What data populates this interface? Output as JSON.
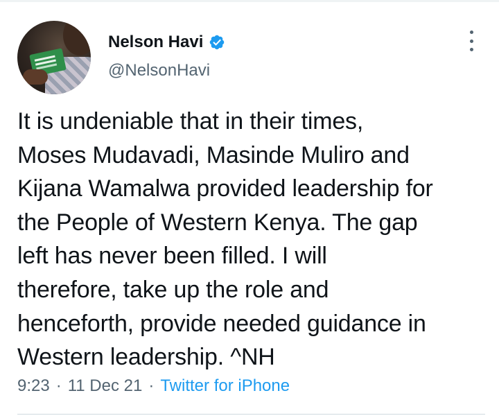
{
  "author": {
    "display_name": "Nelson Havi",
    "handle": "@NelsonHavi",
    "verified": true
  },
  "tweet": {
    "text": "It is undeniable that in their times,\nMoses Mudavadi, Masinde Muliro and\nKijana Wamalwa provided leadership for\nthe People of Western Kenya. The gap\nleft has never been filled. I will\ntherefore, take up the role and\nhenceforth, provide needed guidance in\nWestern leadership. ^NH",
    "time": "9:23",
    "date": "11 Dec 21",
    "source": "Twitter for iPhone",
    "separator": "·"
  },
  "colors": {
    "text": "#0f1419",
    "secondary": "#536471",
    "accent": "#1d9bf0"
  },
  "icons": {
    "verified": "verified-badge-icon",
    "more": "more-options-icon"
  }
}
